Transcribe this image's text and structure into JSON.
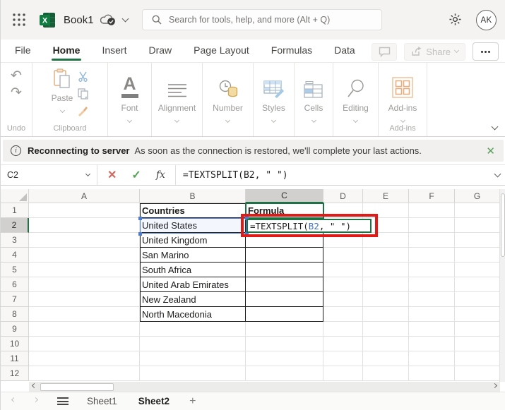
{
  "topbar": {
    "app_title": "Book1",
    "search_placeholder": "Search for tools, help, and more (Alt + Q)",
    "avatar_initials": "AK",
    "icons": [
      "app-launcher-icon",
      "excel-logo",
      "saved-to-cloud-icon",
      "settings-gear-icon",
      "search-icon"
    ]
  },
  "menubar": {
    "tabs": [
      "File",
      "Home",
      "Insert",
      "Draw",
      "Page Layout",
      "Formulas",
      "Data"
    ],
    "active_tab": "Home",
    "share_label": "Share"
  },
  "ribbon": {
    "undo_group": "Undo",
    "paste_label": "Paste",
    "clipboard_group": "Clipboard",
    "font_label": "Font",
    "alignment_label": "Alignment",
    "number_label": "Number",
    "styles_label": "Styles",
    "cells_label": "Cells",
    "editing_label": "Editing",
    "addins_label": "Add-ins",
    "addins_group": "Add-ins"
  },
  "notification": {
    "title": "Reconnecting to server",
    "message": "As soon as the connection is restored, we'll complete your last actions."
  },
  "formula_bar": {
    "name_box": "C2",
    "fx": "fx",
    "formula": "=TEXTSPLIT(B2, \" \")"
  },
  "grid": {
    "columns": [
      "A",
      "B",
      "C",
      "D",
      "E",
      "F",
      "G"
    ],
    "row_count": 12,
    "selected_column": "C",
    "selected_row": 2,
    "cells": {
      "B1": "Countries",
      "C1": "Formula",
      "B2": "United States",
      "B3": "United Kingdom",
      "B4": "San Marino",
      "B5": "South Africa",
      "B6": "United Arab Emirates",
      "B7": "New Zealand",
      "B8": "North Macedonia"
    },
    "bold_cells": [
      "B1",
      "C1"
    ],
    "edit_cell": {
      "ref": "C2",
      "parts": [
        "=TEXTSPLIT(",
        "B2",
        ", \" \")"
      ]
    }
  },
  "sheet_bar": {
    "sheets": [
      "Sheet1",
      "Sheet2"
    ],
    "active_sheet": "Sheet2"
  },
  "colors": {
    "excel_green": "#217346",
    "annotation_red": "#e01b17",
    "reference_blue": "#4472c4",
    "selection_blue": "#4f7bd0"
  }
}
